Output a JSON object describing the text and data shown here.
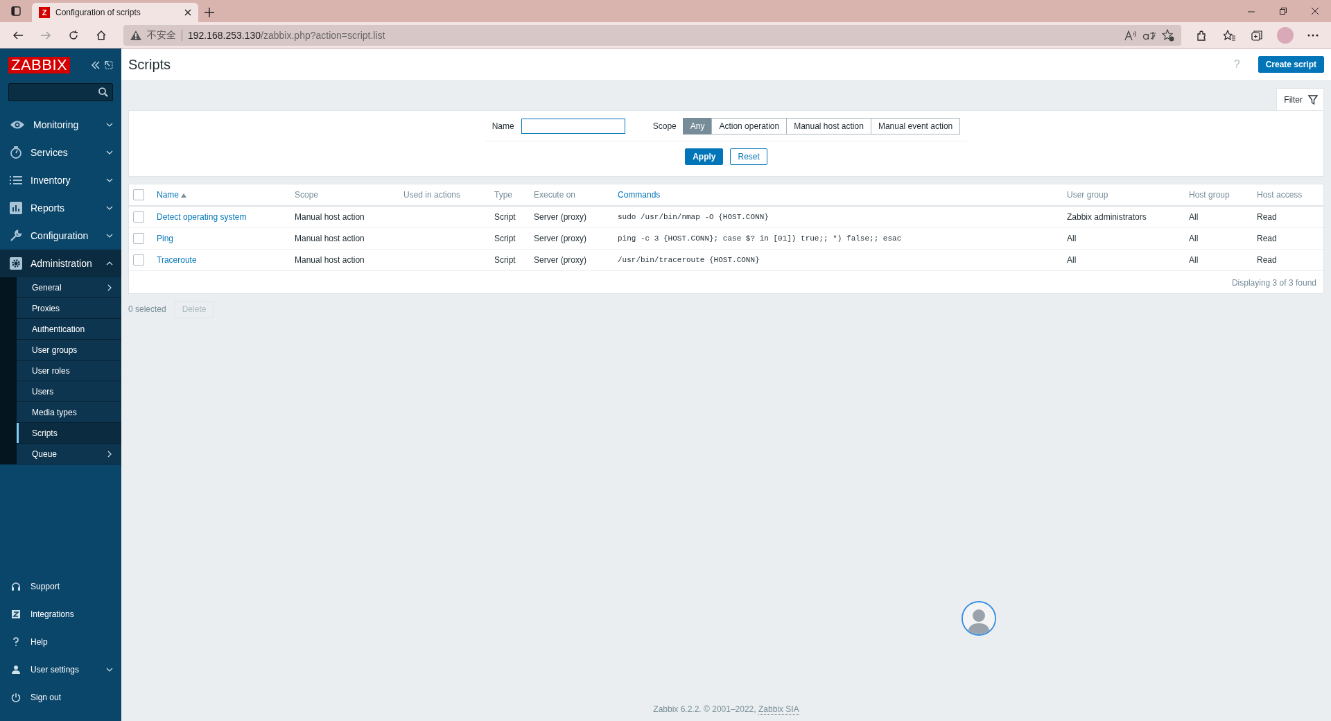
{
  "browser": {
    "tab_title": "Configuration of scripts",
    "favicon": "Z",
    "security_warning": "不安全",
    "url_host": "192.168.253.130",
    "url_path": "/zabbix.php?action=script.list"
  },
  "sidebar": {
    "logo": "ZABBIX",
    "menu": [
      {
        "label": "Monitoring",
        "expanded": false,
        "selected": false
      },
      {
        "label": "Services",
        "expanded": false,
        "selected": false
      },
      {
        "label": "Inventory",
        "expanded": false,
        "selected": false
      },
      {
        "label": "Reports",
        "expanded": false,
        "selected": false
      },
      {
        "label": "Configuration",
        "expanded": false,
        "selected": false
      },
      {
        "label": "Administration",
        "expanded": true,
        "selected": true,
        "children": [
          {
            "label": "General",
            "submenu": true,
            "selected": false
          },
          {
            "label": "Proxies",
            "submenu": false,
            "selected": false
          },
          {
            "label": "Authentication",
            "submenu": false,
            "selected": false
          },
          {
            "label": "User groups",
            "submenu": false,
            "selected": false
          },
          {
            "label": "User roles",
            "submenu": false,
            "selected": false
          },
          {
            "label": "Users",
            "submenu": false,
            "selected": false
          },
          {
            "label": "Media types",
            "submenu": false,
            "selected": false
          },
          {
            "label": "Scripts",
            "submenu": false,
            "selected": true
          },
          {
            "label": "Queue",
            "submenu": true,
            "selected": false
          }
        ]
      }
    ],
    "bottom": [
      {
        "label": "Support",
        "expandable": false
      },
      {
        "label": "Integrations",
        "expandable": false
      },
      {
        "label": "Help",
        "expandable": false
      },
      {
        "label": "User settings",
        "expandable": true
      },
      {
        "label": "Sign out",
        "expandable": false
      }
    ]
  },
  "header": {
    "title": "Scripts",
    "help": "?",
    "create_button": "Create script"
  },
  "filter": {
    "tab_label": "Filter",
    "name_label": "Name",
    "scope_label": "Scope",
    "scope_options": [
      {
        "label": "Any",
        "selected": true
      },
      {
        "label": "Action operation",
        "selected": false
      },
      {
        "label": "Manual host action",
        "selected": false
      },
      {
        "label": "Manual event action",
        "selected": false
      }
    ],
    "apply": "Apply",
    "reset": "Reset"
  },
  "table": {
    "select_all_checked": false,
    "columns": [
      {
        "label": "Name",
        "sortable": true,
        "sorted": true
      },
      {
        "label": "Scope",
        "sortable": false,
        "sorted": false
      },
      {
        "label": "Used in actions",
        "sortable": false,
        "sorted": false
      },
      {
        "label": "Type",
        "sortable": false,
        "sorted": false
      },
      {
        "label": "Execute on",
        "sortable": false,
        "sorted": false
      },
      {
        "label": "Commands",
        "sortable": true,
        "sorted": false
      },
      {
        "label": "User group",
        "sortable": false,
        "sorted": false
      },
      {
        "label": "Host group",
        "sortable": false,
        "sorted": false
      },
      {
        "label": "Host access",
        "sortable": false,
        "sorted": false
      }
    ],
    "rows": [
      {
        "checked": false,
        "cells": [
          "Detect operating system",
          "Manual host action",
          "",
          "Script",
          "Server (proxy)",
          "sudo /usr/bin/nmap -O {HOST.CONN}",
          "Zabbix administrators",
          "All",
          "Read"
        ]
      },
      {
        "checked": false,
        "cells": [
          "Ping",
          "Manual host action",
          "",
          "Script",
          "Server (proxy)",
          "ping -c 3 {HOST.CONN}; case $? in [01]) true;; *) false;; esac",
          "All",
          "All",
          "Read"
        ]
      },
      {
        "checked": false,
        "cells": [
          "Traceroute",
          "Manual host action",
          "",
          "Script",
          "Server (proxy)",
          "/usr/bin/traceroute {HOST.CONN}",
          "All",
          "All",
          "Read"
        ]
      }
    ],
    "summary": "Displaying 3 of 3 found"
  },
  "actions": {
    "selected_count": "0 selected",
    "delete_button": "Delete",
    "delete_disabled": true
  },
  "footer": {
    "text": "Zabbix 6.2.2. © 2001–2022, ",
    "link": "Zabbix SIA"
  }
}
